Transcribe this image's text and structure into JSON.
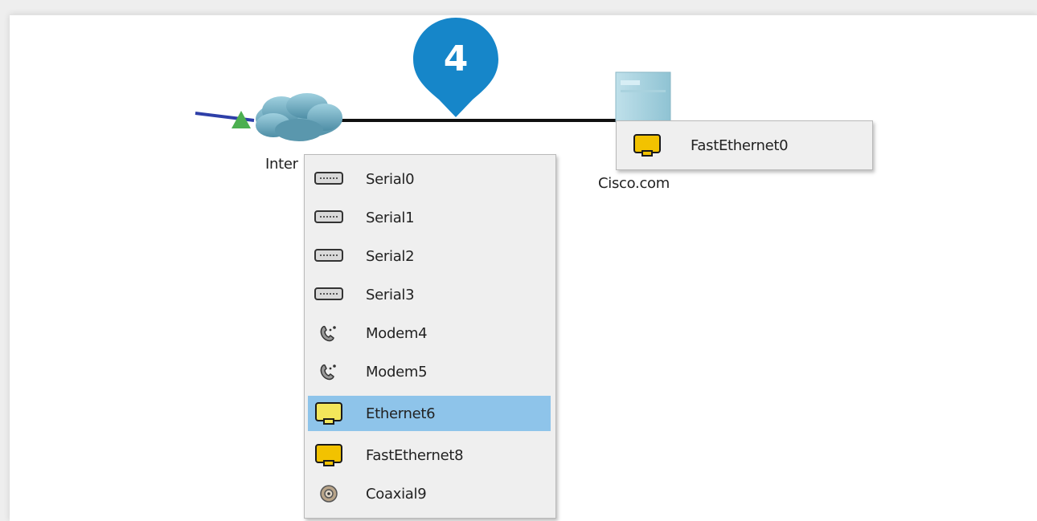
{
  "step": {
    "number": "4",
    "color": "#1686c9"
  },
  "devices": {
    "internet": {
      "label": "Inter",
      "icon": "cloud-icon"
    },
    "server": {
      "label": "Cisco.com",
      "icon": "server-icon"
    }
  },
  "links": {
    "incoming_color": "#2e3fa8",
    "connection_color": "#111111",
    "port_status_color": "#4caf50"
  },
  "ports_menu": {
    "items": [
      {
        "label": "Serial0",
        "icon": "serial-port-icon"
      },
      {
        "label": "Serial1",
        "icon": "serial-port-icon"
      },
      {
        "label": "Serial2",
        "icon": "serial-port-icon"
      },
      {
        "label": "Serial3",
        "icon": "serial-port-icon"
      },
      {
        "label": "Modem4",
        "icon": "modem-port-icon"
      },
      {
        "label": "Modem5",
        "icon": "modem-port-icon"
      },
      {
        "label": "Ethernet6",
        "icon": "ethernet-port-icon",
        "selected": true
      },
      {
        "label": "FastEthernet8",
        "icon": "ethernet-port-icon"
      },
      {
        "label": "Coaxial9",
        "icon": "coaxial-port-icon"
      }
    ],
    "selected_color": "#8ec4ea"
  },
  "server_menu": {
    "items": [
      {
        "label": "FastEthernet0",
        "icon": "ethernet-port-icon"
      }
    ]
  }
}
